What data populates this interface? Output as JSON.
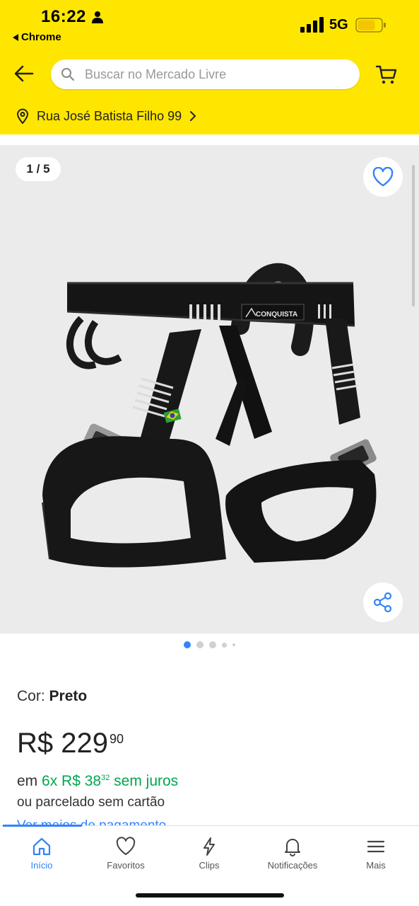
{
  "status_bar": {
    "time": "16:22",
    "back_app": "Chrome",
    "network": "5G"
  },
  "search": {
    "placeholder": "Buscar no Mercado Livre"
  },
  "address": {
    "label": "Rua José Batista Filho 99"
  },
  "gallery": {
    "counter": "1 / 5",
    "brand_label": "CONQUISTA",
    "total_images": 5,
    "current_image": 1
  },
  "product": {
    "color_label": "Cor: ",
    "color_value": "Preto",
    "price_currency": "R$",
    "price_integer": "229",
    "price_cents": "90",
    "installments_prefix": "em ",
    "installments_count": "6x R$ 38",
    "installments_cents": "32",
    "installments_suffix": " sem juros",
    "installments_alt": "ou parcelado sem cartão",
    "payment_link": "Ver meios de pagamento"
  },
  "tabs": [
    {
      "label": "Início",
      "icon": "home-icon",
      "active": true
    },
    {
      "label": "Favoritos",
      "icon": "heart-icon",
      "active": false
    },
    {
      "label": "Clips",
      "icon": "bolt-icon",
      "active": false
    },
    {
      "label": "Notificações",
      "icon": "bell-icon",
      "active": false
    },
    {
      "label": "Mais",
      "icon": "menu-icon",
      "active": false
    }
  ],
  "colors": {
    "header_bg": "#ffe600",
    "accent_blue": "#3483fa",
    "green": "#00a650"
  }
}
